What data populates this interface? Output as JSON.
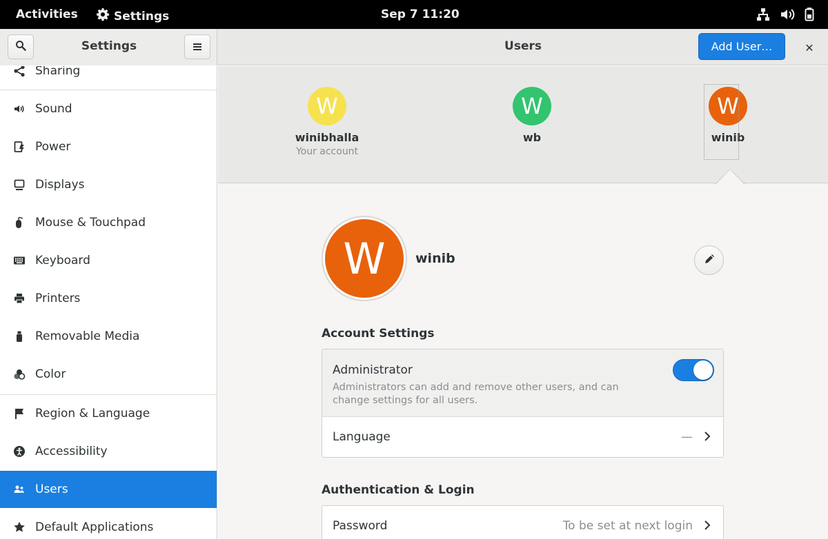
{
  "topbar": {
    "activities": "Activities",
    "app_name": "Settings",
    "clock": "Sep 7  11:20",
    "tray_icons": [
      "network-icon",
      "volume-icon",
      "battery-icon"
    ]
  },
  "headerbar": {
    "sidebar_title": "Settings",
    "page_title": "Users",
    "add_user_label": "Add User…",
    "close_label": "✕"
  },
  "sidebar": {
    "items": [
      {
        "label": "Sharing",
        "icon": "share-icon"
      },
      {
        "label": "Sound",
        "icon": "speaker-icon"
      },
      {
        "label": "Power",
        "icon": "power-icon"
      },
      {
        "label": "Displays",
        "icon": "display-icon"
      },
      {
        "label": "Mouse & Touchpad",
        "icon": "mouse-icon"
      },
      {
        "label": "Keyboard",
        "icon": "keyboard-icon"
      },
      {
        "label": "Printers",
        "icon": "printer-icon"
      },
      {
        "label": "Removable Media",
        "icon": "usb-icon"
      },
      {
        "label": "Color",
        "icon": "color-icon"
      },
      {
        "label": "Region & Language",
        "icon": "flag-icon"
      },
      {
        "label": "Accessibility",
        "icon": "accessibility-icon"
      },
      {
        "label": "Users",
        "icon": "users-icon",
        "active": true
      },
      {
        "label": "Default Applications",
        "icon": "star-icon"
      }
    ]
  },
  "users": [
    {
      "initial": "W",
      "name": "winibhalla",
      "subtitle": "Your account",
      "color": "#f6e24f"
    },
    {
      "initial": "W",
      "name": "wb",
      "subtitle": "",
      "color": "#33c46f"
    },
    {
      "initial": "W",
      "name": "winib",
      "subtitle": "",
      "color": "#e8620b",
      "selected": true
    }
  ],
  "selected_user": {
    "initial": "W",
    "name": "winib",
    "avatar_color": "#e8620b"
  },
  "account_settings": {
    "title": "Account Settings",
    "administrator": {
      "label": "Administrator",
      "description": "Administrators can add and remove other users, and can change settings for all users.",
      "enabled": true
    },
    "language": {
      "label": "Language",
      "value": "—"
    }
  },
  "authentication": {
    "title": "Authentication & Login",
    "password": {
      "label": "Password",
      "value": "To be set at next login"
    }
  },
  "colors": {
    "accent": "#1a7fe0",
    "topbar": "#000000"
  }
}
